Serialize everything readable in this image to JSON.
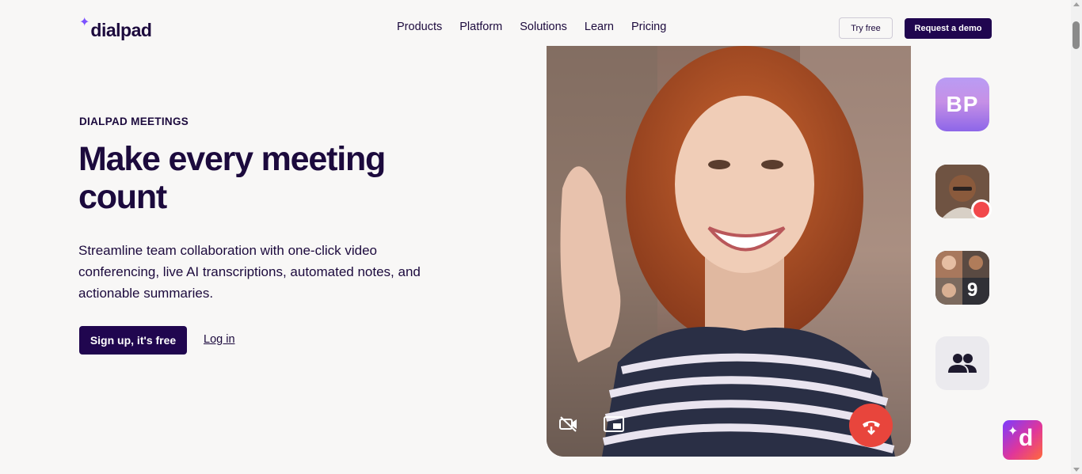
{
  "brand": {
    "logo_text": "dialpad"
  },
  "nav": {
    "items": [
      "Products",
      "Platform",
      "Solutions",
      "Learn",
      "Pricing"
    ],
    "try_free": "Try free",
    "request_demo": "Request a demo"
  },
  "hero": {
    "eyebrow": "DIALPAD MEETINGS",
    "title": "Make every meeting count",
    "description": "Streamline team collaboration with one-click video conferencing, live AI transcriptions, automated notes, and actionable summaries.",
    "signup": "Sign up, it's free",
    "login": "Log in"
  },
  "tiles": {
    "bp_initials": "BP",
    "group_count": "9"
  },
  "colors": {
    "brand_dark": "#20064f",
    "accent_purple": "#7c52ff",
    "end_call_red": "#e8453c",
    "record_red": "#f2484b"
  },
  "icons": [
    "sparkle-icon",
    "camera-off-icon",
    "picture-in-picture-icon",
    "end-call-icon",
    "people-icon",
    "dialpad-ai-icon"
  ]
}
